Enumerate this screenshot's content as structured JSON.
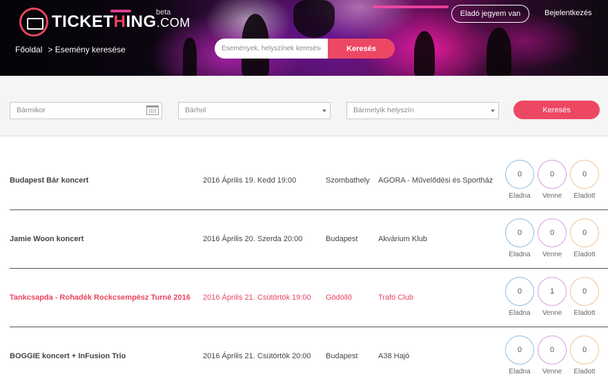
{
  "header": {
    "logo_main": "TICKET",
    "logo_accent": "H",
    "logo_rest": "ING",
    "logo_domain": ".COM",
    "beta": "beta",
    "breadcrumb": [
      "Főoldal",
      "> Esemény keresése"
    ],
    "search_placeholder": "Események, helyszínek keresése",
    "search_button": "Keresés",
    "sell_button": "Eladó jegyem van",
    "login_link": "Bejelentkezés"
  },
  "filters": {
    "date_placeholder": "Bármikor",
    "city_placeholder": "Bárhol",
    "venue_placeholder": "Bármelyik helyszín",
    "search_button": "Keresés"
  },
  "stat_labels": {
    "sell": "Eladna",
    "buy": "Venne",
    "sold": "Eladott"
  },
  "events": [
    {
      "name": "Budapest Bár koncert",
      "date": "2016 Április 19. Kedd 19:00",
      "city": "Szombathely",
      "venue": "AGORA - Művelődési és Sportház",
      "sell": "0",
      "buy": "0",
      "sold": "0",
      "highlight": false
    },
    {
      "name": "Jamie Woon koncert",
      "date": "2016 Április 20. Szerda 20:00",
      "city": "Budapest",
      "venue": "Akvárium Klub",
      "sell": "0",
      "buy": "0",
      "sold": "0",
      "highlight": false
    },
    {
      "name": "Tankcsapda - Rohadék Rockcsempész Turné 2016",
      "date": "2016 Április 21. Csütörtök 19:00",
      "city": "Gödöllő",
      "venue": "Trafó Club",
      "sell": "0",
      "buy": "1",
      "sold": "0",
      "highlight": true
    },
    {
      "name": "BOGGIE koncert + InFusion Trio",
      "date": "2016 Április 21. Csütörtök 20:00",
      "city": "Budapest",
      "venue": "A38 Hajó",
      "sell": "0",
      "buy": "0",
      "sold": "0",
      "highlight": false
    }
  ],
  "colors": {
    "accent": "#ed4863",
    "sell_ring": "#8cbbe8",
    "buy_ring": "#d39fd8",
    "sold_ring": "#efc195"
  }
}
